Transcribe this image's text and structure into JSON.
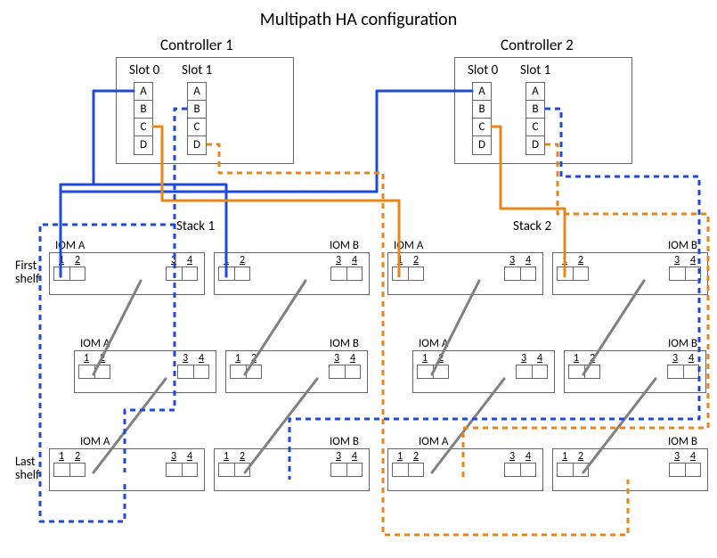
{
  "title": "Multipath HA configuration",
  "controllers": [
    {
      "label": "Controller 1",
      "slots": [
        {
          "label": "Slot 0",
          "ports": [
            "A",
            "B",
            "C",
            "D"
          ]
        },
        {
          "label": "Slot 1",
          "ports": [
            "A",
            "B",
            "C",
            "D"
          ]
        }
      ]
    },
    {
      "label": "Controller 2",
      "slots": [
        {
          "label": "Slot 0",
          "ports": [
            "A",
            "B",
            "C",
            "D"
          ]
        },
        {
          "label": "Slot 1",
          "ports": [
            "A",
            "B",
            "C",
            "D"
          ]
        }
      ]
    }
  ],
  "stacks": [
    {
      "label": "Stack 1",
      "iomA": "IOM A",
      "iomB": "IOM B"
    },
    {
      "label": "Stack 2",
      "iomA": "IOM A",
      "iomB": "IOM B"
    }
  ],
  "side_labels": {
    "first": "First\nshelf",
    "last": "Last\nshelf"
  },
  "side_labels_first_l1": "First",
  "side_labels_first_l2": "shelf",
  "side_labels_last_l1": "Last",
  "side_labels_last_l2": "shelf",
  "port_numbers": {
    "p1": "1",
    "p2": "2",
    "p3": "3",
    "p4": "4"
  },
  "connections": {
    "solid_blue": [
      {
        "from": "C1.Slot0.A",
        "to": "Stack1.first.IOMA.port1"
      },
      {
        "from": "C2.Slot0.A",
        "to": "Stack1.first.IOMB.port1"
      }
    ],
    "solid_orange": [
      {
        "from": "C1.Slot0.C",
        "to": "Stack2.first.IOMA.port1"
      },
      {
        "from": "C2.Slot0.C",
        "to": "Stack2.first.IOMB.port1"
      }
    ],
    "dashed_blue": [
      {
        "from": "C1.Slot1.D",
        "to": "Stack1.last.IOMB.port3"
      },
      {
        "from": "C2.Slot1.B",
        "to": "Stack1.last.IOMA.port3"
      }
    ],
    "dashed_orange": [
      {
        "from": "C1.Slot1.D",
        "to": "Stack2.last.IOMB.port3"
      },
      {
        "from": "C2.Slot1.D",
        "to": "Stack2.last.IOMA.port3"
      }
    ],
    "shelf_links": "Each stack: three shelves; shelf N port3 → shelf N+1 port1 on both IOM A and IOM B via gray diagonal links"
  }
}
